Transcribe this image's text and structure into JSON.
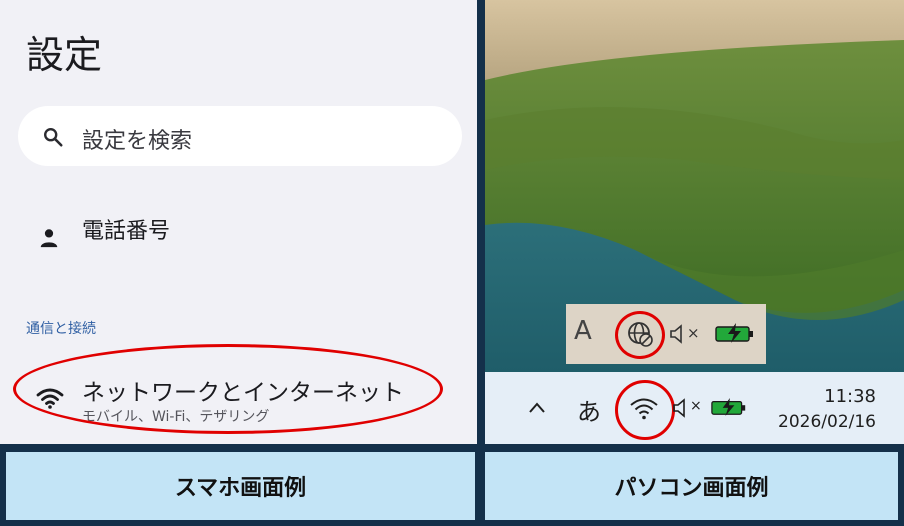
{
  "phone": {
    "title": "設定",
    "search_placeholder": "設定を検索",
    "phone_number_label": "電話番号",
    "section_header": "通信と接続",
    "network_title": "ネットワークとインターネット",
    "network_subtitle": "モバイル、Wi-Fi、テザリング"
  },
  "pc": {
    "zoom_ime": "A",
    "taskbar_ime": "あ",
    "mute_symbol": "×",
    "clock_time": "11:38",
    "clock_date": "2026/02/16",
    "icons": [
      "chevron-up-icon",
      "globe-no-connection-icon",
      "wifi-icon",
      "speaker-muted-icon",
      "battery-charging-icon"
    ]
  },
  "captions": {
    "phone": "スマホ画面例",
    "pc": "パソコン画面例"
  },
  "colors": {
    "highlight": "#e00000",
    "caption_bg": "#c3e4f6",
    "border": "#14304a",
    "battery": "#22a83a"
  }
}
